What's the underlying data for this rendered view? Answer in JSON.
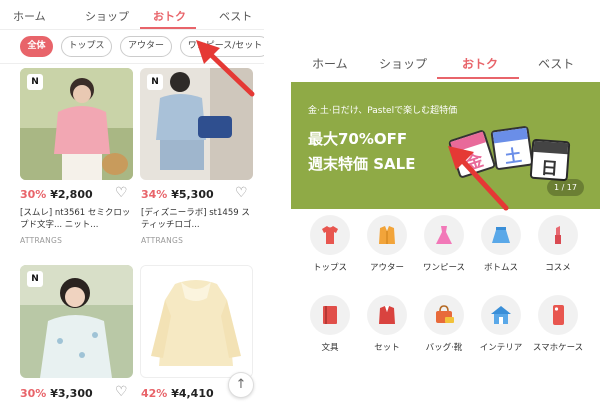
{
  "left": {
    "tabs": [
      {
        "label": "ホーム"
      },
      {
        "label": "ショップ"
      },
      {
        "label": "おトク"
      },
      {
        "label": "ベスト"
      }
    ],
    "chips": [
      {
        "label": "全体"
      },
      {
        "label": "トップス"
      },
      {
        "label": "アウター"
      },
      {
        "label": "ワンピース/セット"
      }
    ],
    "products": [
      {
        "badge": "N",
        "discount": "30%",
        "price": "¥2,800",
        "title": "[スムレ] nt3561 セミクロップド文字... ニット...",
        "brand": "ATTRANGS"
      },
      {
        "badge": "N",
        "discount": "34%",
        "price": "¥5,300",
        "title": "[ディズニーラボ] st1459 スティッチロゴ...",
        "brand": "ATTRANGS"
      },
      {
        "badge": "N",
        "discount": "30%",
        "price": "¥3,300"
      },
      {
        "discount": "42%",
        "price": "¥4,410"
      }
    ],
    "scroll_top_icon": "arrow-up-icon"
  },
  "right": {
    "tabs": [
      {
        "label": "ホーム"
      },
      {
        "label": "ショップ"
      },
      {
        "label": "おトク"
      },
      {
        "label": "ベスト"
      }
    ],
    "banner": {
      "small": "金·土·日だけ、Pastelで楽しむ超特価",
      "line1": "最大70%OFF",
      "line2": "週末特価 SALE",
      "pager": "1 / 17",
      "calendar_chars": [
        "金",
        "土",
        "日"
      ],
      "bg_color": "#8faa46"
    },
    "categories": [
      {
        "label": "トップス",
        "icon": "tshirt-icon"
      },
      {
        "label": "アウター",
        "icon": "coat-icon"
      },
      {
        "label": "ワンピース",
        "icon": "dress-icon"
      },
      {
        "label": "ボトムス",
        "icon": "skirt-icon"
      },
      {
        "label": "コスメ",
        "icon": "lipstick-icon"
      },
      {
        "label": "文具",
        "icon": "notebook-icon"
      },
      {
        "label": "セット",
        "icon": "suit-icon"
      },
      {
        "label": "バッグ·靴",
        "icon": "bag-icon"
      },
      {
        "label": "インテリア",
        "icon": "house-icon"
      },
      {
        "label": "スマホケース",
        "icon": "phone-case-icon"
      }
    ]
  },
  "accent_color": "#e8646a"
}
